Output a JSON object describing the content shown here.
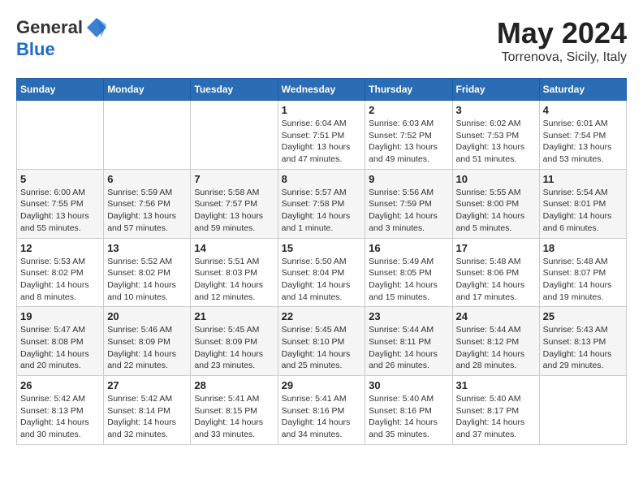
{
  "header": {
    "logo_line1": "General",
    "logo_line2": "Blue",
    "month_title": "May 2024",
    "location": "Torrenova, Sicily, Italy"
  },
  "days_of_week": [
    "Sunday",
    "Monday",
    "Tuesday",
    "Wednesday",
    "Thursday",
    "Friday",
    "Saturday"
  ],
  "weeks": [
    [
      {
        "day": "",
        "info": ""
      },
      {
        "day": "",
        "info": ""
      },
      {
        "day": "",
        "info": ""
      },
      {
        "day": "1",
        "info": "Sunrise: 6:04 AM\nSunset: 7:51 PM\nDaylight: 13 hours\nand 47 minutes."
      },
      {
        "day": "2",
        "info": "Sunrise: 6:03 AM\nSunset: 7:52 PM\nDaylight: 13 hours\nand 49 minutes."
      },
      {
        "day": "3",
        "info": "Sunrise: 6:02 AM\nSunset: 7:53 PM\nDaylight: 13 hours\nand 51 minutes."
      },
      {
        "day": "4",
        "info": "Sunrise: 6:01 AM\nSunset: 7:54 PM\nDaylight: 13 hours\nand 53 minutes."
      }
    ],
    [
      {
        "day": "5",
        "info": "Sunrise: 6:00 AM\nSunset: 7:55 PM\nDaylight: 13 hours\nand 55 minutes."
      },
      {
        "day": "6",
        "info": "Sunrise: 5:59 AM\nSunset: 7:56 PM\nDaylight: 13 hours\nand 57 minutes."
      },
      {
        "day": "7",
        "info": "Sunrise: 5:58 AM\nSunset: 7:57 PM\nDaylight: 13 hours\nand 59 minutes."
      },
      {
        "day": "8",
        "info": "Sunrise: 5:57 AM\nSunset: 7:58 PM\nDaylight: 14 hours\nand 1 minute."
      },
      {
        "day": "9",
        "info": "Sunrise: 5:56 AM\nSunset: 7:59 PM\nDaylight: 14 hours\nand 3 minutes."
      },
      {
        "day": "10",
        "info": "Sunrise: 5:55 AM\nSunset: 8:00 PM\nDaylight: 14 hours\nand 5 minutes."
      },
      {
        "day": "11",
        "info": "Sunrise: 5:54 AM\nSunset: 8:01 PM\nDaylight: 14 hours\nand 6 minutes."
      }
    ],
    [
      {
        "day": "12",
        "info": "Sunrise: 5:53 AM\nSunset: 8:02 PM\nDaylight: 14 hours\nand 8 minutes."
      },
      {
        "day": "13",
        "info": "Sunrise: 5:52 AM\nSunset: 8:02 PM\nDaylight: 14 hours\nand 10 minutes."
      },
      {
        "day": "14",
        "info": "Sunrise: 5:51 AM\nSunset: 8:03 PM\nDaylight: 14 hours\nand 12 minutes."
      },
      {
        "day": "15",
        "info": "Sunrise: 5:50 AM\nSunset: 8:04 PM\nDaylight: 14 hours\nand 14 minutes."
      },
      {
        "day": "16",
        "info": "Sunrise: 5:49 AM\nSunset: 8:05 PM\nDaylight: 14 hours\nand 15 minutes."
      },
      {
        "day": "17",
        "info": "Sunrise: 5:48 AM\nSunset: 8:06 PM\nDaylight: 14 hours\nand 17 minutes."
      },
      {
        "day": "18",
        "info": "Sunrise: 5:48 AM\nSunset: 8:07 PM\nDaylight: 14 hours\nand 19 minutes."
      }
    ],
    [
      {
        "day": "19",
        "info": "Sunrise: 5:47 AM\nSunset: 8:08 PM\nDaylight: 14 hours\nand 20 minutes."
      },
      {
        "day": "20",
        "info": "Sunrise: 5:46 AM\nSunset: 8:09 PM\nDaylight: 14 hours\nand 22 minutes."
      },
      {
        "day": "21",
        "info": "Sunrise: 5:45 AM\nSunset: 8:09 PM\nDaylight: 14 hours\nand 23 minutes."
      },
      {
        "day": "22",
        "info": "Sunrise: 5:45 AM\nSunset: 8:10 PM\nDaylight: 14 hours\nand 25 minutes."
      },
      {
        "day": "23",
        "info": "Sunrise: 5:44 AM\nSunset: 8:11 PM\nDaylight: 14 hours\nand 26 minutes."
      },
      {
        "day": "24",
        "info": "Sunrise: 5:44 AM\nSunset: 8:12 PM\nDaylight: 14 hours\nand 28 minutes."
      },
      {
        "day": "25",
        "info": "Sunrise: 5:43 AM\nSunset: 8:13 PM\nDaylight: 14 hours\nand 29 minutes."
      }
    ],
    [
      {
        "day": "26",
        "info": "Sunrise: 5:42 AM\nSunset: 8:13 PM\nDaylight: 14 hours\nand 30 minutes."
      },
      {
        "day": "27",
        "info": "Sunrise: 5:42 AM\nSunset: 8:14 PM\nDaylight: 14 hours\nand 32 minutes."
      },
      {
        "day": "28",
        "info": "Sunrise: 5:41 AM\nSunset: 8:15 PM\nDaylight: 14 hours\nand 33 minutes."
      },
      {
        "day": "29",
        "info": "Sunrise: 5:41 AM\nSunset: 8:16 PM\nDaylight: 14 hours\nand 34 minutes."
      },
      {
        "day": "30",
        "info": "Sunrise: 5:40 AM\nSunset: 8:16 PM\nDaylight: 14 hours\nand 35 minutes."
      },
      {
        "day": "31",
        "info": "Sunrise: 5:40 AM\nSunset: 8:17 PM\nDaylight: 14 hours\nand 37 minutes."
      },
      {
        "day": "",
        "info": ""
      }
    ]
  ]
}
